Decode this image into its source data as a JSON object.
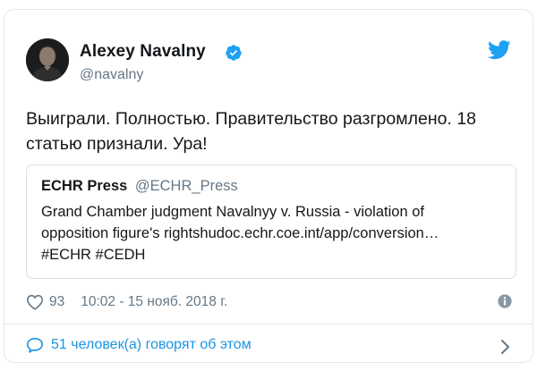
{
  "author": {
    "name": "Alexey Navalny",
    "handle": "@navalny",
    "verified": true
  },
  "tweet": {
    "text": "Выиграли. Полностью. Правительство разгромлено. 18 статью признали. Ура!"
  },
  "quoted": {
    "name": "ECHR Press",
    "handle": "@ECHR_Press",
    "lines": [
      "Grand Chamber judgment  Navalnyy v. Russia - violation of",
      "opposition figure's rightshudoc.echr.coe.int/app/conversion…",
      "#ECHR #CEDH"
    ]
  },
  "meta": {
    "likes": "93",
    "timestamp": "10:02 - 15 нояб. 2018 г."
  },
  "conversation": {
    "label": "51 человек(а) говорят об этом"
  },
  "icons": {
    "verified": "verified-badge-icon",
    "brand": "twitter-bird-icon",
    "like": "heart-icon",
    "info": "info-icon",
    "reply": "speech-bubble-icon",
    "more": "chevron-right-icon"
  },
  "colors": {
    "brand_blue": "#1da1f2",
    "link_blue": "#1b95e0",
    "text": "#14171a",
    "muted": "#657786",
    "border": "#e1e8ed"
  }
}
